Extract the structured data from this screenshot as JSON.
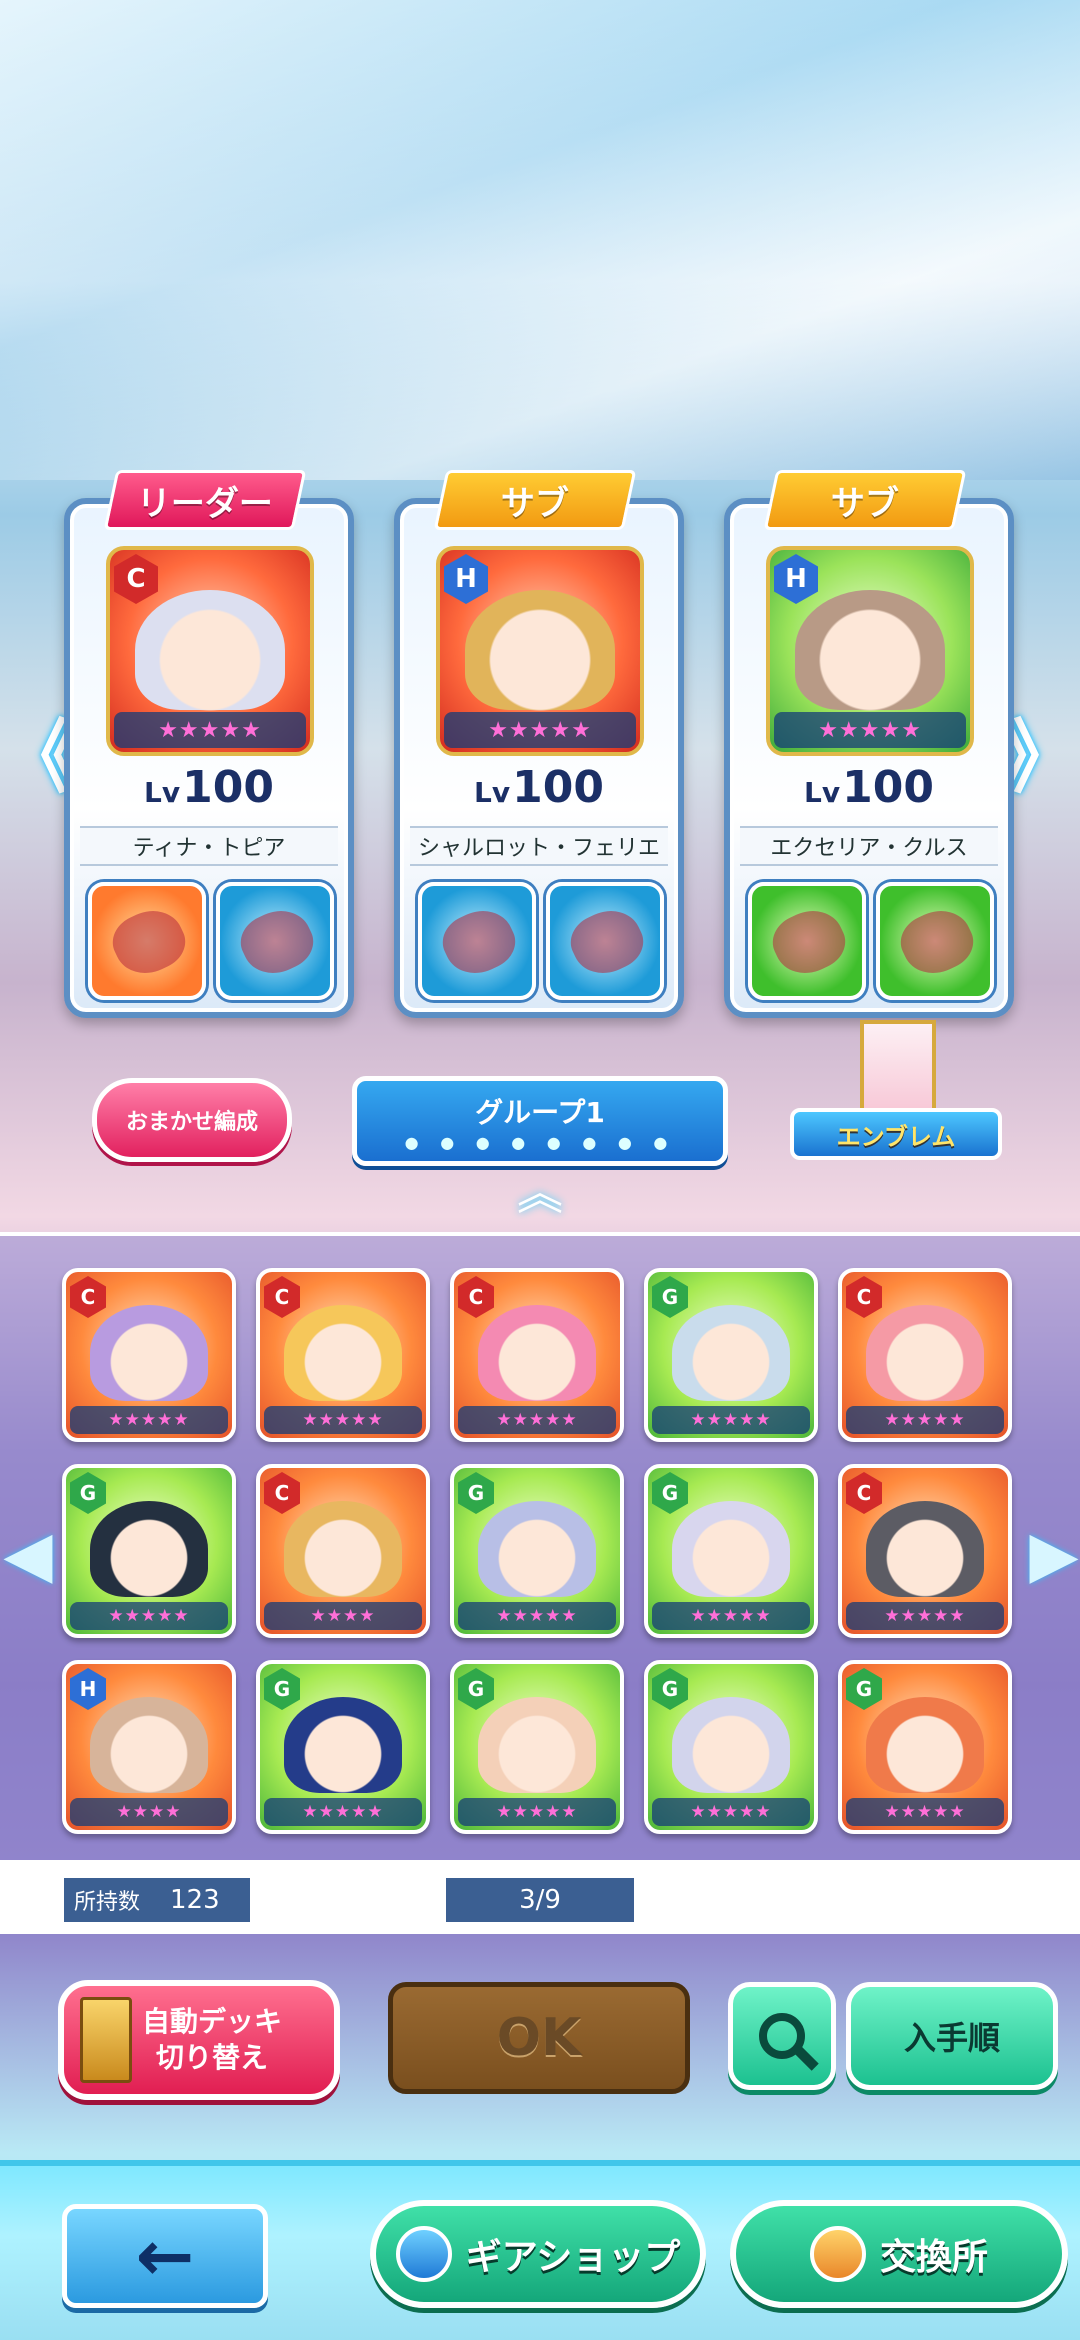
{
  "leaders": [
    {
      "tag": "リーダー",
      "tag_type": "leader",
      "rank": "C",
      "level_prefix": "Lv",
      "level": "100",
      "name": "ティナ・トピア",
      "bg": "red",
      "hair": "#dcdff0",
      "stars": "★★★★★",
      "gear1": "orange",
      "gear2": "blue"
    },
    {
      "tag": "サブ",
      "tag_type": "sub",
      "rank": "H",
      "level_prefix": "Lv",
      "level": "100",
      "name": "シャルロット・フェリエ",
      "bg": "red",
      "hair": "#e1b45a",
      "stars": "★★★★★",
      "gear1": "blue",
      "gear2": "blue"
    },
    {
      "tag": "サブ",
      "tag_type": "sub",
      "rank": "H",
      "level_prefix": "Lv",
      "level": "100",
      "name": "エクセリア・クルス",
      "bg": "green",
      "hair": "#b89a86",
      "stars": "★★★★★",
      "gear1": "green",
      "gear2": "green"
    }
  ],
  "controls": {
    "omakase": "おまかせ編成",
    "group_label": "グループ1",
    "group_dots": "● ● ● ● ● ● ● ●",
    "emblem": "エンブレム",
    "expand": "︽"
  },
  "grid": [
    {
      "rank": "C",
      "bg": "orange",
      "hair": "#b89be0",
      "stars": "★★★★★"
    },
    {
      "rank": "C",
      "bg": "orange",
      "hair": "#f6c75a",
      "stars": "★★★★★"
    },
    {
      "rank": "C",
      "bg": "orange",
      "hair": "#f48ab2",
      "stars": "★★★★★"
    },
    {
      "rank": "G",
      "bg": "green",
      "hair": "#c9dcec",
      "stars": "★★★★★"
    },
    {
      "rank": "C",
      "bg": "orange",
      "hair": "#f59aa5",
      "stars": "★★★★★"
    },
    {
      "rank": "G",
      "bg": "green",
      "hair": "#243040",
      "stars": "★★★★★"
    },
    {
      "rank": "C",
      "bg": "orange",
      "hair": "#e8b760",
      "stars": "★★★★"
    },
    {
      "rank": "G",
      "bg": "green",
      "hair": "#b8bfe6",
      "stars": "★★★★★"
    },
    {
      "rank": "G",
      "bg": "green",
      "hair": "#d8d6ee",
      "stars": "★★★★★"
    },
    {
      "rank": "C",
      "bg": "orange",
      "hair": "#5c5c64",
      "stars": "★★★★★"
    },
    {
      "rank": "H",
      "bg": "orange",
      "hair": "#d7b49a",
      "stars": "★★★★"
    },
    {
      "rank": "G",
      "bg": "green",
      "hair": "#243c8a",
      "stars": "★★★★★"
    },
    {
      "rank": "G",
      "bg": "green",
      "hair": "#f4d0b8",
      "stars": "★★★★★"
    },
    {
      "rank": "G",
      "bg": "green",
      "hair": "#d2d4ec",
      "stars": "★★★★★"
    },
    {
      "rank": "G",
      "bg": "orange",
      "hair": "#f07a4a",
      "stars": "★★★★★"
    }
  ],
  "counts": {
    "owned_label": "所持数",
    "owned_value": "123",
    "page": "3/9"
  },
  "actions": {
    "autodeck_line1": "自動デッキ",
    "autodeck_line2": "切り替え",
    "ok": "OK",
    "sort": "入手順"
  },
  "footer": {
    "back_icon": "←",
    "gearshop": "ギアショップ",
    "exchange": "交換所"
  },
  "side_arrow_left": "《",
  "side_arrow_right": "》",
  "grid_arrow_left": "◀",
  "grid_arrow_right": "▶"
}
